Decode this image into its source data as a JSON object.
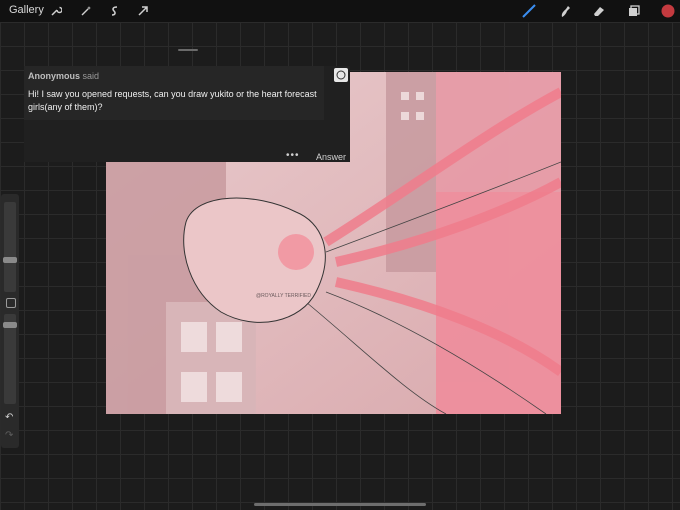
{
  "toolbar": {
    "gallery_label": "Gallery",
    "left_tools": [
      "wrench-icon",
      "magic-wand-icon",
      "selection-icon",
      "transform-arrow-icon"
    ],
    "right_tools": [
      "brush-icon",
      "smudge-icon",
      "eraser-icon",
      "layers-icon",
      "color-swatch"
    ],
    "active_color": "#c43a3f",
    "brush_accent": "#3a8df0"
  },
  "ask": {
    "sender": "Anonymous",
    "said": "said",
    "message": "Hi! I saw you opened requests, can you draw yukito or the heart forecast girls(any of them)?",
    "answer_label": "Answer",
    "more_label": "•••"
  },
  "canvas": {
    "watermark": "@ROYALLY TERRIFIED"
  }
}
